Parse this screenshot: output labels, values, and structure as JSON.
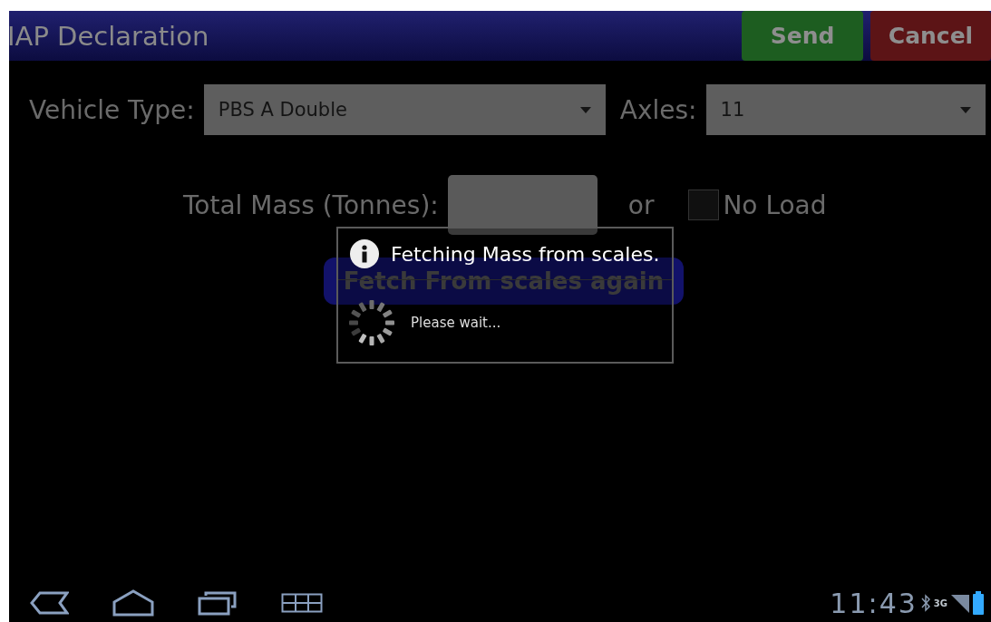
{
  "title": "IAP Declaration",
  "actions": [
    {
      "label": "Send",
      "kind": "confirm"
    },
    {
      "label": "Cancel",
      "kind": "cancel"
    }
  ],
  "vehicle_type": {
    "label": "Vehicle Type:",
    "value": "PBS A Double"
  },
  "axles": {
    "label": "Axles:",
    "value": "11"
  },
  "total_mass": {
    "label": "Total Mass (Tonnes):",
    "or": "or",
    "no_load": {
      "label": "No Load",
      "checked": false
    }
  },
  "fetch_button": "Fetch From scales again",
  "dialog": {
    "title": "Fetching Mass from scales.",
    "message": "Please wait..."
  },
  "status_bar": {
    "time": "11:43",
    "network": "3G"
  }
}
